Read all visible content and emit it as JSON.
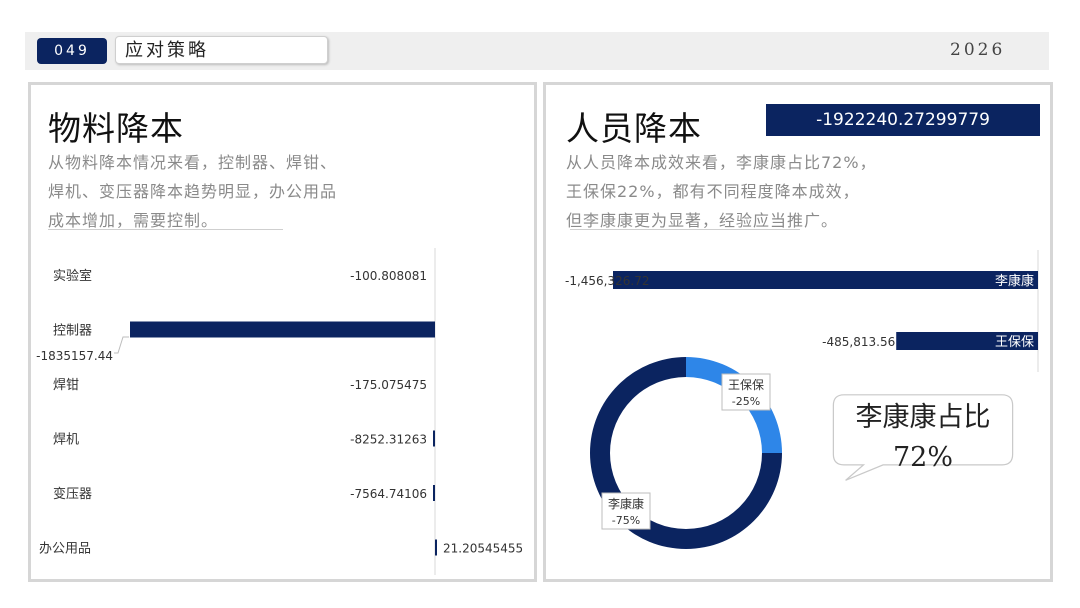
{
  "header": {
    "page_number": "049",
    "title": "应对策略",
    "year": "2026"
  },
  "left_panel": {
    "title": "物料降本",
    "desc_lines": [
      "从物料降本情况来看，控制器、焊钳、",
      "焊机、变压器降本趋势明显，办公用品",
      "成本增加，需要控制。"
    ]
  },
  "right_panel": {
    "title": "人员降本",
    "badge_value": "-1922240.27299779",
    "desc_lines": [
      "从人员降本成效来看，李康康占比72%，",
      "王保保22%，都有不同程度降本成效，",
      "但李康康更为显著，经验应当推广。"
    ],
    "callout_lines": [
      "李康康占比",
      "72%"
    ]
  },
  "colors": {
    "navy": "#0b2460",
    "blue": "#2e86e8",
    "panel_border": "#d6d6d6"
  },
  "chart_data": [
    {
      "type": "bar",
      "orientation": "horizontal",
      "categories": [
        "实验室",
        "控制器",
        "焊钳",
        "焊机",
        "变压器",
        "办公用品"
      ],
      "values": [
        -100.808081,
        -1835157.44,
        -175.075475,
        -8252.31263,
        -7564.74106,
        21.20545455
      ],
      "value_labels": [
        "-100.808081",
        "-1835157.44",
        "-175.075475",
        "-8252.31263",
        "-7564.74106",
        "21.20545455"
      ],
      "xlim": [
        -1835157.44,
        0
      ]
    },
    {
      "type": "bar",
      "orientation": "horizontal",
      "categories": [
        "李康康",
        "王保保"
      ],
      "values": [
        -1456326.72,
        -485813.56
      ],
      "value_labels": [
        "-1,456,326.72",
        "-485,813.56"
      ],
      "xlim": [
        -1456326.72,
        0
      ]
    },
    {
      "type": "pie",
      "donut": true,
      "categories": [
        "王保保",
        "李康康"
      ],
      "values": [
        25,
        75
      ],
      "labels": [
        "-25%",
        "-75%"
      ]
    }
  ]
}
